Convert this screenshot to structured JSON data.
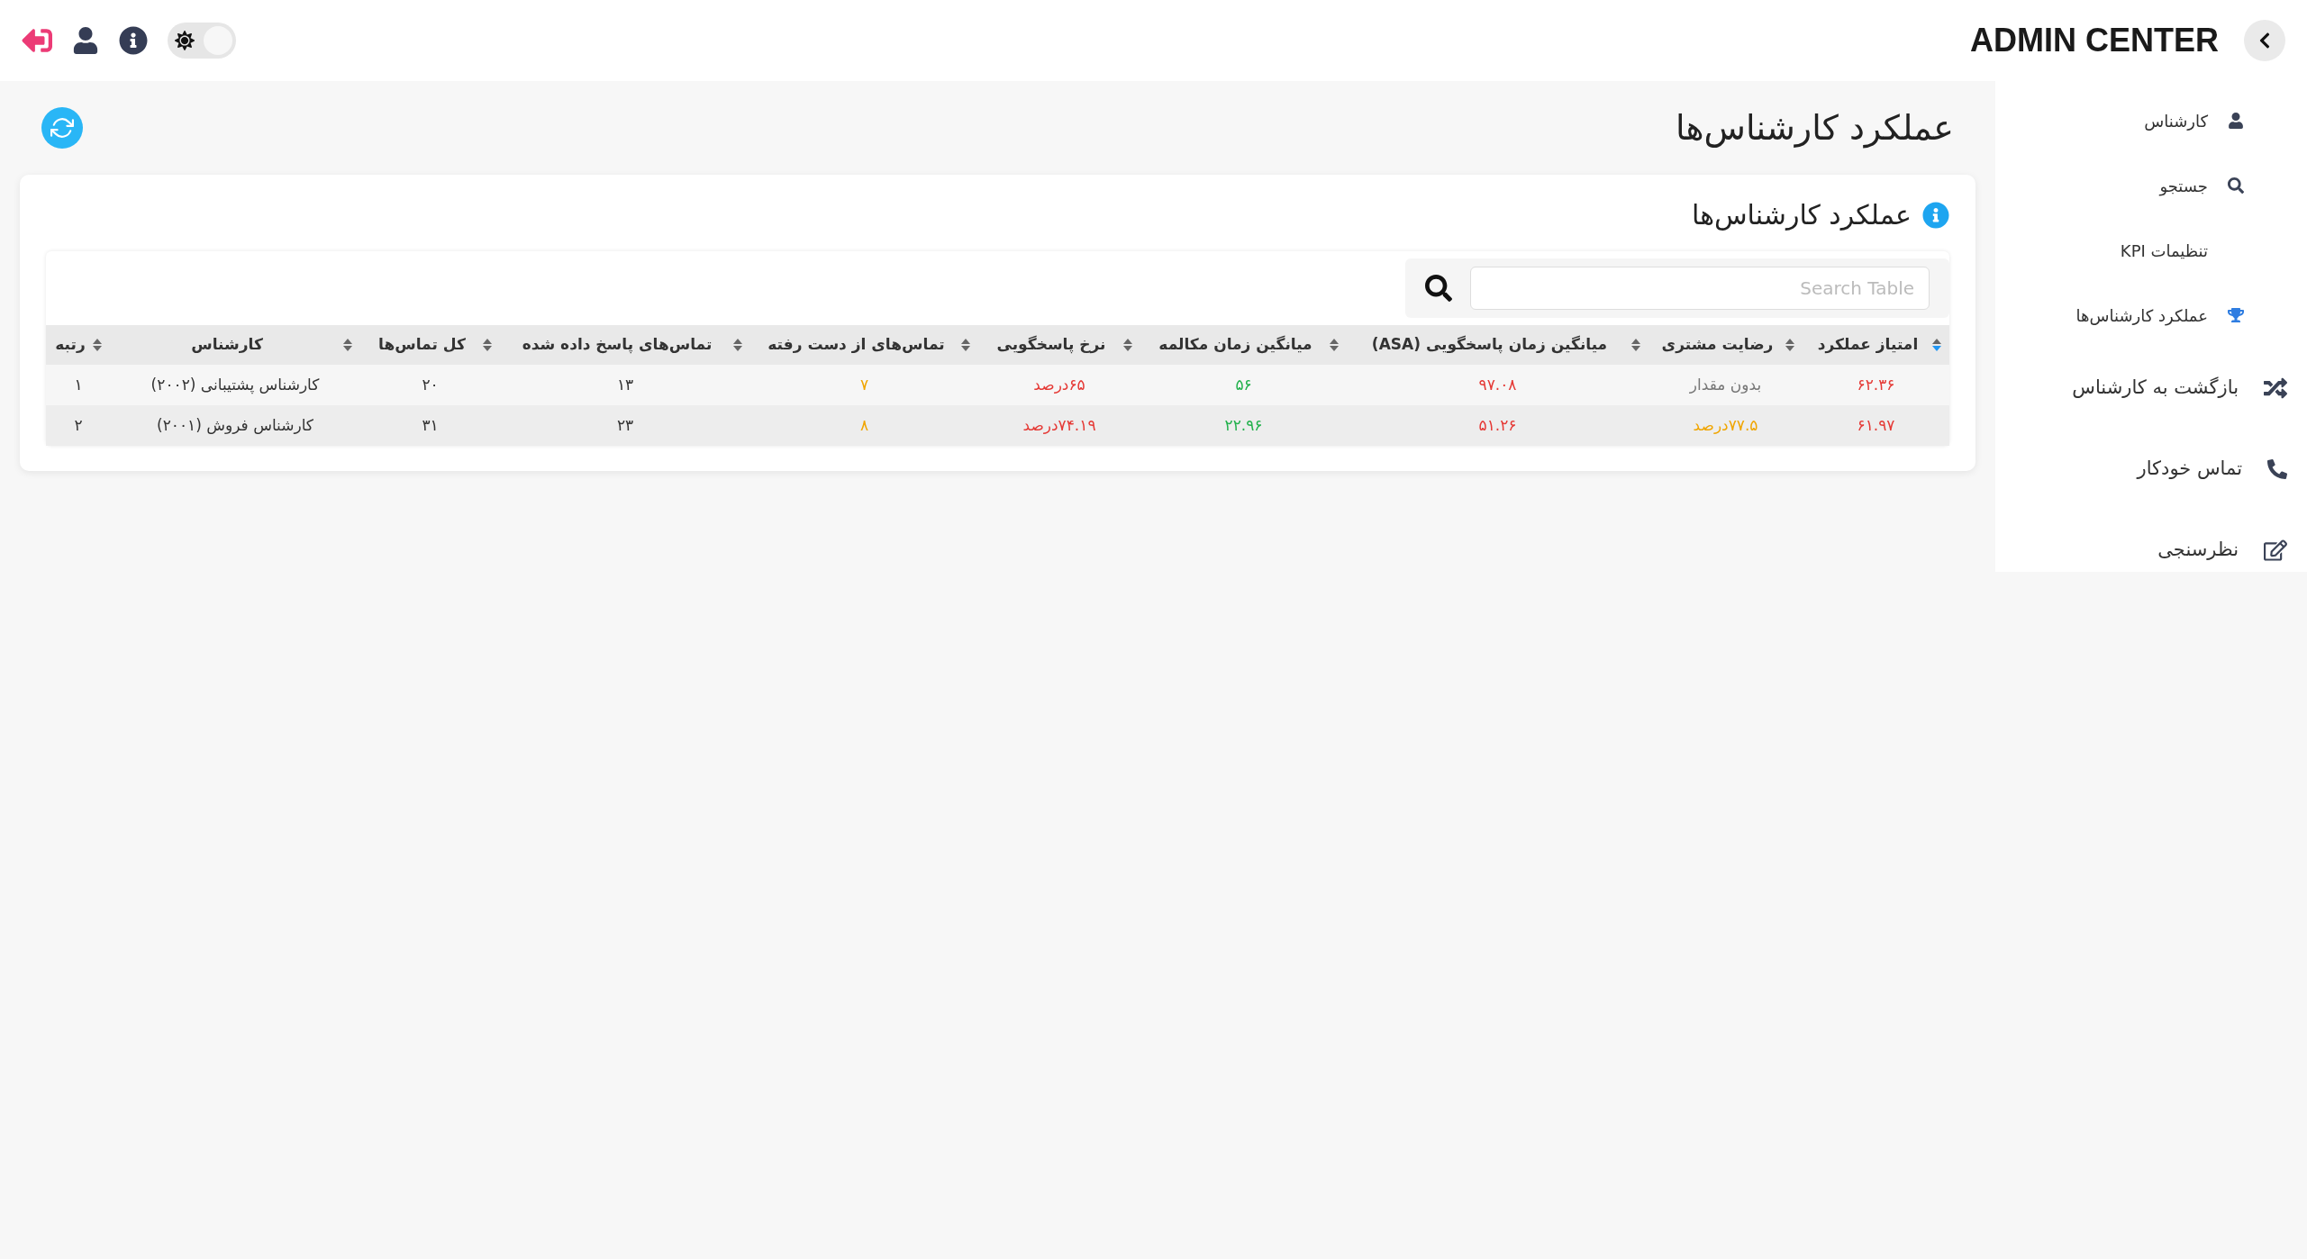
{
  "header": {
    "brand": "ADMIN CENTER",
    "theme_toggle": {
      "on": false
    }
  },
  "sidebar": {
    "items": [
      {
        "kind": "sub",
        "label": "کارشناس"
      },
      {
        "kind": "sub",
        "label": "جستجو"
      },
      {
        "kind": "sub",
        "label": "تنظیمات KPI"
      },
      {
        "kind": "sub",
        "label": "عملکرد کارشناس‌ها"
      },
      {
        "kind": "main",
        "label": "بازگشت به کارشناس"
      },
      {
        "kind": "main",
        "label": "تماس خودکار"
      },
      {
        "kind": "main",
        "label": "نظرسنجی"
      }
    ]
  },
  "page_title": "عملکرد کارشناس‌ها",
  "card": {
    "title": "عملکرد کارشناس‌ها",
    "search": {
      "placeholder": "Search Table"
    },
    "table": {
      "columns": [
        {
          "label": "امتیاز عملکرد",
          "sorted": true
        },
        {
          "label": "رضایت مشتری",
          "sorted": false
        },
        {
          "label": "میانگین زمان پاسخگویی (ASA)",
          "sorted": false
        },
        {
          "label": "میانگین زمان مکالمه",
          "sorted": false
        },
        {
          "label": "نرخ پاسخگویی",
          "sorted": false
        },
        {
          "label": "تماس‌های از دست رفته",
          "sorted": false
        },
        {
          "label": "تماس‌های پاسخ داده شده",
          "sorted": false
        },
        {
          "label": "کل تماس‌ها",
          "sorted": false
        },
        {
          "label": "کارشناس",
          "sorted": false
        },
        {
          "label": "رتبه",
          "sorted": false
        }
      ],
      "rows": [
        [
          {
            "text": "۶۲.۳۶",
            "color": "#e53935"
          },
          {
            "text": "بدون مقدار",
            "color": "#777777"
          },
          {
            "text": "۹۷.۰۸",
            "color": "#e53935"
          },
          {
            "text": "۵۶",
            "color": "#22b14c"
          },
          {
            "text": "۶۵درصد",
            "color": "#e53935"
          },
          {
            "text": "۷",
            "color": "#f0a500"
          },
          {
            "text": "۱۳"
          },
          {
            "text": "۲۰"
          },
          {
            "text": "کارشناس پشتیبانی (۲۰۰۲)"
          },
          {
            "text": "۱"
          }
        ],
        [
          {
            "text": "۶۱.۹۷",
            "color": "#e53935"
          },
          {
            "text": "۷۷.۵درصد",
            "color": "#f0a500"
          },
          {
            "text": "۵۱.۲۶",
            "color": "#e53935"
          },
          {
            "text": "۲۲.۹۶",
            "color": "#22b14c"
          },
          {
            "text": "۷۴.۱۹درصد",
            "color": "#e53935"
          },
          {
            "text": "۸",
            "color": "#f0a500"
          },
          {
            "text": "۲۳"
          },
          {
            "text": "۳۱"
          },
          {
            "text": "کارشناس فروش (۲۰۰۱)"
          },
          {
            "text": "۲"
          }
        ]
      ]
    }
  }
}
